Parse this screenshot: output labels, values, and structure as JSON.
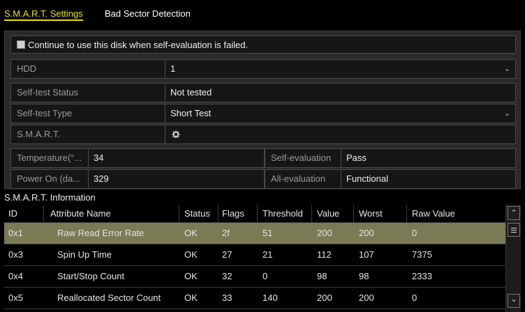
{
  "tabs": [
    {
      "label": "S.M.A.R.T. Settings",
      "active": true
    },
    {
      "label": "Bad Sector Detection",
      "active": false
    }
  ],
  "continue_checkbox": {
    "label": "Continue to use this disk when self-evaluation is failed.",
    "checked": false
  },
  "fields": {
    "hdd": {
      "label": "HDD",
      "value": "1"
    },
    "self_test_status": {
      "label": "Self-test Status",
      "value": "Not tested"
    },
    "self_test_type": {
      "label": "Self-test Type",
      "value": "Short Test"
    },
    "smart": {
      "label": "S.M.A.R.T.",
      "icon": "gear-icon"
    },
    "temperature": {
      "label": "Temperature(°...",
      "value": "34"
    },
    "power_on": {
      "label": "Power On (da...",
      "value": "329"
    },
    "self_evaluation": {
      "label": "Self-evaluation",
      "value": "Pass"
    },
    "all_evaluation": {
      "label": "All-evaluation",
      "value": "Functional"
    }
  },
  "smart_info": {
    "title": "S.M.A.R.T. Information",
    "columns": [
      "ID",
      "Attribute Name",
      "Status",
      "Flags",
      "Threshold",
      "Value",
      "Worst",
      "Raw Value"
    ],
    "rows": [
      [
        "0x1",
        "Raw Read Error Rate",
        "OK",
        "2f",
        "51",
        "200",
        "200",
        "0"
      ],
      [
        "0x3",
        "Spin Up Time",
        "OK",
        "27",
        "21",
        "112",
        "107",
        "7375"
      ],
      [
        "0x4",
        "Start/Stop Count",
        "OK",
        "32",
        "0",
        "98",
        "98",
        "2333"
      ],
      [
        "0x5",
        "Reallocated Sector Count",
        "OK",
        "33",
        "140",
        "200",
        "200",
        "0"
      ]
    ],
    "selected_row": 0
  },
  "colors": {
    "accent": "#f0e300",
    "selected_row": "#7a7a55",
    "panel": "#2a2a2a"
  },
  "scrollbar": {
    "up_icon": "chevron-up-icon",
    "down_icon": "chevron-down-icon",
    "thumb_icon": "grip-icon"
  }
}
